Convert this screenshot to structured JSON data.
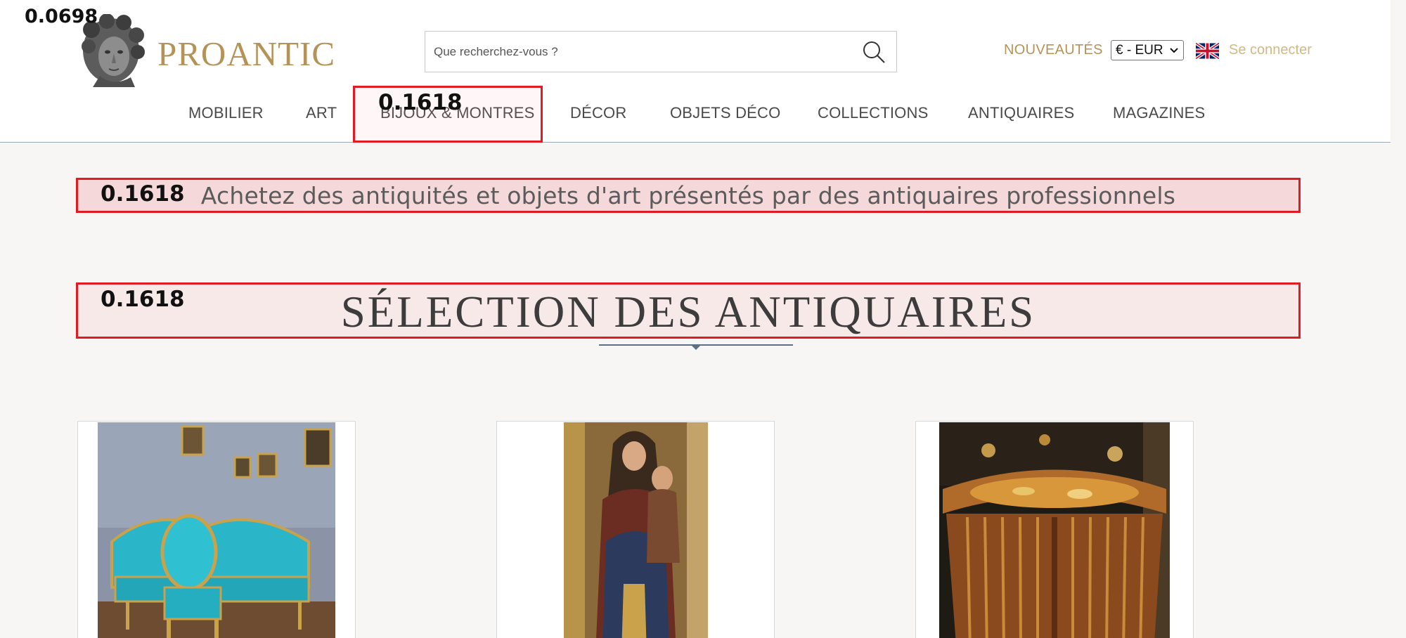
{
  "corner_label": "0.0698",
  "header": {
    "logo_text": "PROANTIC",
    "search_placeholder": "Que recherchez-vous ?",
    "nouveautes_label": "NOUVEAUTÉS",
    "currency_value": "€ - EUR",
    "language_flag": "uk-flag-icon",
    "connect_label": "Se connecter"
  },
  "nav": {
    "items": [
      {
        "label": "MOBILIER"
      },
      {
        "label": "ART"
      },
      {
        "label": "BIJOUX & MONTRES"
      },
      {
        "label": "DÉCOR"
      },
      {
        "label": "OBJETS DÉCO"
      },
      {
        "label": "COLLECTIONS"
      },
      {
        "label": "ANTIQUAIRES"
      },
      {
        "label": "MAGAZINES"
      }
    ]
  },
  "overlays": {
    "nav_label": "0.1618",
    "tagline_label": "0.1618",
    "title_label": "0.1618",
    "box_color": "#e01b24"
  },
  "main": {
    "tagline": "Achetez des antiquités et objets d'art présentés par des antiquaires professionnels",
    "section_title": "SÉLECTION DES ANTIQUAIRES",
    "products": [
      {
        "subject": "blue-upholstered-settee-and-armchair"
      },
      {
        "subject": "painted-virgin-and-child-statue"
      },
      {
        "subject": "marquetry-demilune-commode"
      }
    ]
  },
  "colors": {
    "brand_gold": "#b49358",
    "page_background": "#f7f6f4",
    "divider": "#9aa8b5"
  }
}
